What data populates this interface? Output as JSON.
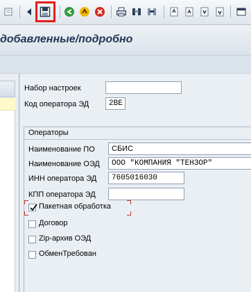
{
  "toolbar": {
    "icons": [
      "back-icon",
      "save-icon",
      "green-back-icon",
      "exit-icon",
      "cancel-icon",
      "print-icon",
      "find-icon",
      "find-next-icon",
      "first-page-icon",
      "previous-page-icon",
      "next-page-icon",
      "last-page-icon"
    ],
    "highlight_color": "#e2201d"
  },
  "title": "добавленные/подробно",
  "settings": {
    "preset_label": "Набор настроек",
    "preset_value": "",
    "operator_code_label": "Код оператора ЭД",
    "operator_code_value": "2BE"
  },
  "operators": {
    "group_title": "Операторы",
    "software_name_label": "Наименование ПО",
    "software_name_value": "СБИС",
    "oed_name_label": "Наименование ОЭД",
    "oed_name_value": "ООО \"КОМПАНИЯ \"ТЕНЗОР\"",
    "inn_label": "ИНН оператора ЭД",
    "inn_value": "7605016030",
    "kpp_label": "КПП оператора ЭД",
    "kpp_value": "",
    "checkboxes": [
      {
        "label": "Пакетная обработка",
        "checked": true
      },
      {
        "label": "Договор",
        "checked": false
      },
      {
        "label": "Zip-архив ОЭД",
        "checked": false
      },
      {
        "label": "ОбменТребован",
        "checked": false
      }
    ]
  },
  "colors": {
    "title": "#1f3552",
    "selected_row": "#fff9c9"
  }
}
